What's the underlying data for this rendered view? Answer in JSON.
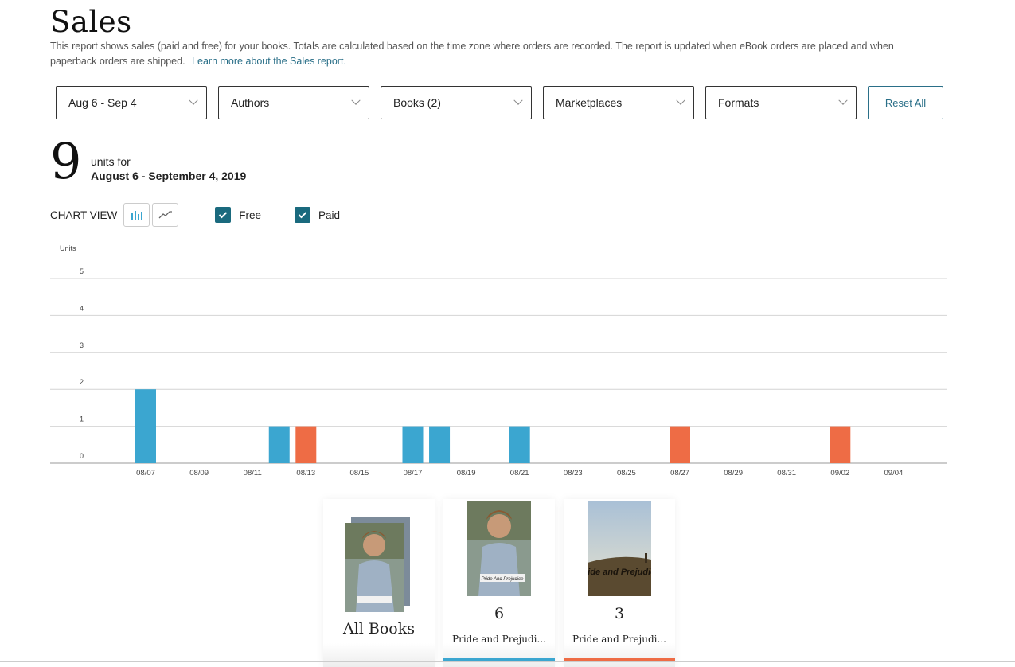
{
  "page": {
    "title": "Sales",
    "description": "This report shows sales (paid and free) for your books. Totals are calculated based on the time zone where orders are recorded. The report is updated when eBook orders are placed and when paperback orders are shipped.",
    "learn_more": "Learn more about the Sales report."
  },
  "filters": {
    "date": "Aug 6 - Sep 4",
    "authors": "Authors",
    "books": "Books (2)",
    "marketplaces": "Marketplaces",
    "formats": "Formats",
    "reset": "Reset All"
  },
  "summary": {
    "count": "9",
    "units_for": "units for",
    "date_range": "August 6 - September 4, 2019"
  },
  "chart_view": {
    "label": "CHART VIEW",
    "bar_icon": "bar-chart-icon",
    "line_icon": "line-chart-icon",
    "free_label": "Free",
    "paid_label": "Paid"
  },
  "colors": {
    "free": "#3ba6d0",
    "paid": "#ee6c45",
    "accent": "#1a6a7e"
  },
  "chart_data": {
    "type": "bar",
    "ylabel": "Units",
    "ylim": [
      0,
      5
    ],
    "yticks": [
      0,
      1,
      2,
      3,
      4,
      5
    ],
    "grid": true,
    "xtick_labels": [
      "08/07",
      "08/09",
      "08/11",
      "08/13",
      "08/15",
      "08/17",
      "08/19",
      "08/21",
      "08/23",
      "08/25",
      "08/27",
      "08/29",
      "08/31",
      "09/02",
      "09/04"
    ],
    "series": [
      {
        "name": "Free",
        "points": [
          {
            "x": "08/07",
            "y": 2
          },
          {
            "x": "08/12",
            "y": 1
          },
          {
            "x": "08/17",
            "y": 1
          },
          {
            "x": "08/18",
            "y": 1
          },
          {
            "x": "08/21",
            "y": 1
          }
        ]
      },
      {
        "name": "Paid",
        "points": [
          {
            "x": "08/13",
            "y": 1
          },
          {
            "x": "08/27",
            "y": 1
          },
          {
            "x": "09/02",
            "y": 1
          }
        ]
      }
    ]
  },
  "books": [
    {
      "title": "All Books",
      "cover_icon": "book-stack-icon"
    },
    {
      "count": "6",
      "name": "Pride and Prejudi...",
      "cover_icon": "book-cover-portrait-icon",
      "cover_text": "Pride And Prejudice"
    },
    {
      "count": "3",
      "name": "Pride and Prejudi...",
      "cover_icon": "book-cover-landscape-icon",
      "cover_text": "Pride and Prejudice"
    }
  ]
}
